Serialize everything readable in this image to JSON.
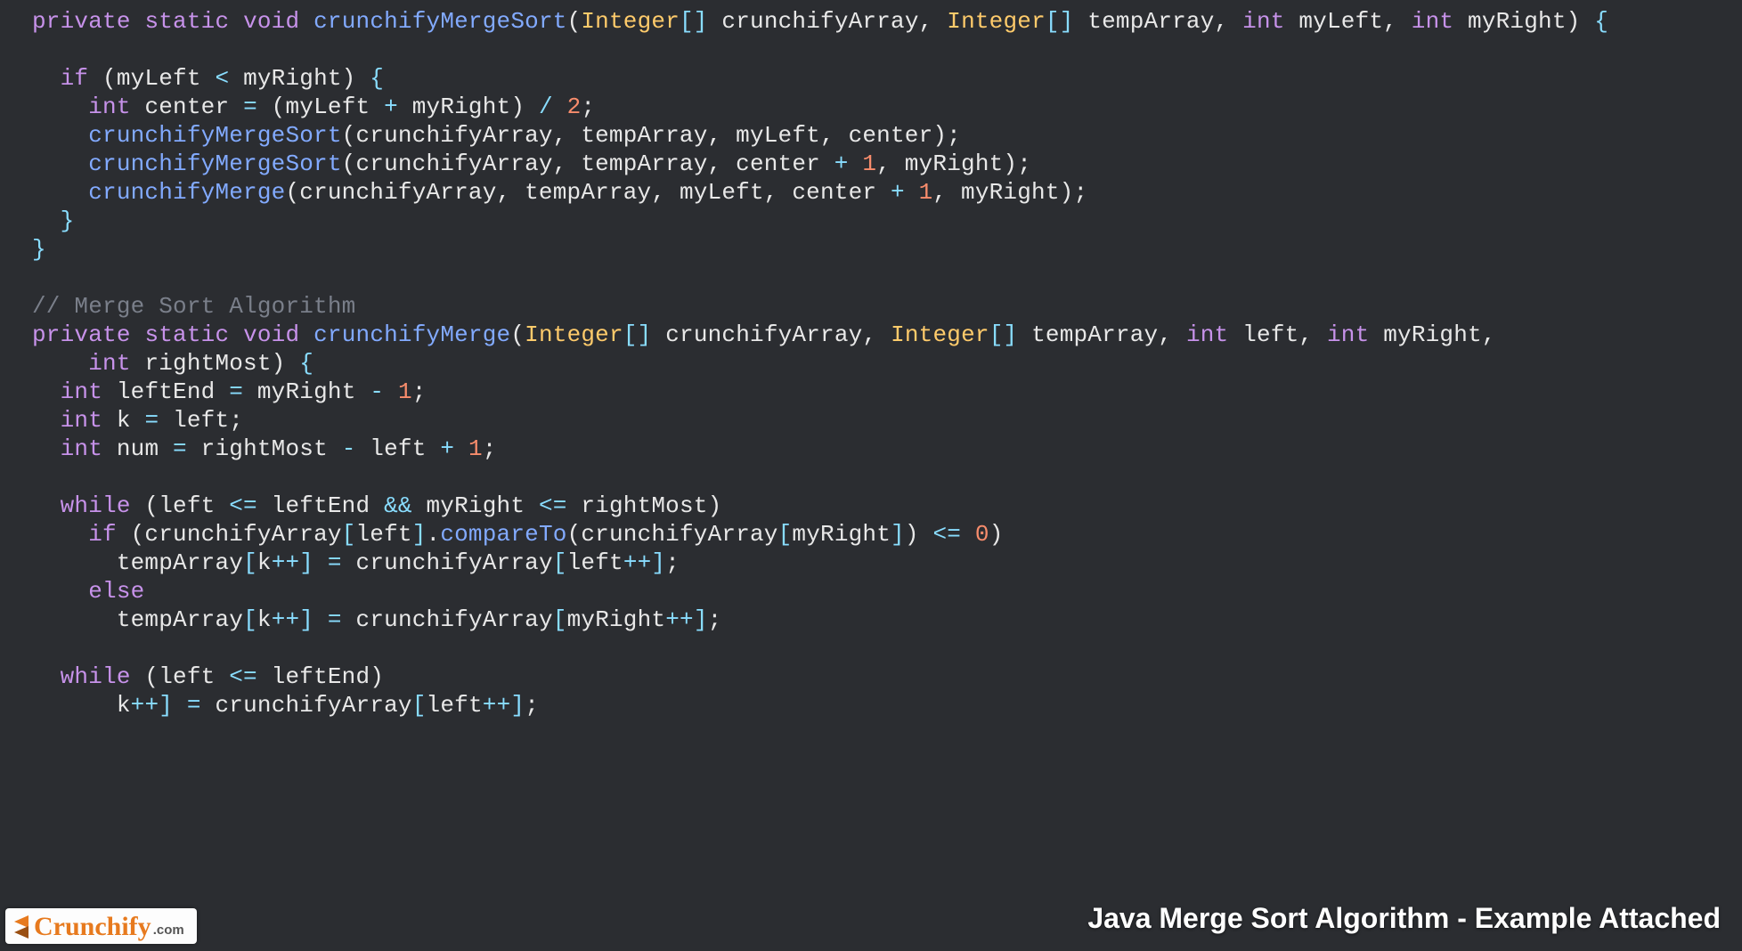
{
  "code": {
    "lines": [
      {
        "i": "",
        "tokens": [
          {
            "c": "kw",
            "t": "private"
          },
          {
            "c": "p",
            "t": " "
          },
          {
            "c": "kw",
            "t": "static"
          },
          {
            "c": "p",
            "t": " "
          },
          {
            "c": "kw",
            "t": "void"
          },
          {
            "c": "p",
            "t": " "
          },
          {
            "c": "fn",
            "t": "crunchifyMergeSort"
          },
          {
            "c": "p",
            "t": "("
          },
          {
            "c": "type",
            "t": "Integer"
          },
          {
            "c": "op",
            "t": "[]"
          },
          {
            "c": "p",
            "t": " crunchifyArray, "
          },
          {
            "c": "type",
            "t": "Integer"
          },
          {
            "c": "op",
            "t": "[]"
          },
          {
            "c": "p",
            "t": " tempArray, "
          },
          {
            "c": "kw",
            "t": "int"
          },
          {
            "c": "p",
            "t": " myLeft, "
          },
          {
            "c": "kw",
            "t": "int"
          },
          {
            "c": "p",
            "t": " myRight) "
          },
          {
            "c": "op",
            "t": "{"
          }
        ]
      },
      {
        "i": "",
        "tokens": []
      },
      {
        "i": "  ",
        "tokens": [
          {
            "c": "kw",
            "t": "if"
          },
          {
            "c": "p",
            "t": " (myLeft "
          },
          {
            "c": "op",
            "t": "<"
          },
          {
            "c": "p",
            "t": " myRight) "
          },
          {
            "c": "op",
            "t": "{"
          }
        ]
      },
      {
        "i": "    ",
        "tokens": [
          {
            "c": "kw",
            "t": "int"
          },
          {
            "c": "p",
            "t": " center "
          },
          {
            "c": "op",
            "t": "="
          },
          {
            "c": "p",
            "t": " (myLeft "
          },
          {
            "c": "op",
            "t": "+"
          },
          {
            "c": "p",
            "t": " myRight) "
          },
          {
            "c": "op",
            "t": "/"
          },
          {
            "c": "p",
            "t": " "
          },
          {
            "c": "num",
            "t": "2"
          },
          {
            "c": "p",
            "t": ";"
          }
        ]
      },
      {
        "i": "    ",
        "tokens": [
          {
            "c": "fn",
            "t": "crunchifyMergeSort"
          },
          {
            "c": "p",
            "t": "(crunchifyArray, tempArray, myLeft, center);"
          }
        ]
      },
      {
        "i": "    ",
        "tokens": [
          {
            "c": "fn",
            "t": "crunchifyMergeSort"
          },
          {
            "c": "p",
            "t": "(crunchifyArray, tempArray, center "
          },
          {
            "c": "op",
            "t": "+"
          },
          {
            "c": "p",
            "t": " "
          },
          {
            "c": "num",
            "t": "1"
          },
          {
            "c": "p",
            "t": ", myRight);"
          }
        ]
      },
      {
        "i": "    ",
        "tokens": [
          {
            "c": "fn",
            "t": "crunchifyMerge"
          },
          {
            "c": "p",
            "t": "(crunchifyArray, tempArray, myLeft, center "
          },
          {
            "c": "op",
            "t": "+"
          },
          {
            "c": "p",
            "t": " "
          },
          {
            "c": "num",
            "t": "1"
          },
          {
            "c": "p",
            "t": ", myRight);"
          }
        ]
      },
      {
        "i": "  ",
        "tokens": [
          {
            "c": "op",
            "t": "}"
          }
        ]
      },
      {
        "i": "",
        "tokens": [
          {
            "c": "op",
            "t": "}"
          }
        ]
      },
      {
        "i": "",
        "tokens": []
      },
      {
        "i": "",
        "tokens": [
          {
            "c": "cmt",
            "t": "// Merge Sort Algorithm"
          }
        ]
      },
      {
        "i": "",
        "tokens": [
          {
            "c": "kw",
            "t": "private"
          },
          {
            "c": "p",
            "t": " "
          },
          {
            "c": "kw",
            "t": "static"
          },
          {
            "c": "p",
            "t": " "
          },
          {
            "c": "kw",
            "t": "void"
          },
          {
            "c": "p",
            "t": " "
          },
          {
            "c": "fn",
            "t": "crunchifyMerge"
          },
          {
            "c": "p",
            "t": "("
          },
          {
            "c": "type",
            "t": "Integer"
          },
          {
            "c": "op",
            "t": "[]"
          },
          {
            "c": "p",
            "t": " crunchifyArray, "
          },
          {
            "c": "type",
            "t": "Integer"
          },
          {
            "c": "op",
            "t": "[]"
          },
          {
            "c": "p",
            "t": " tempArray, "
          },
          {
            "c": "kw",
            "t": "int"
          },
          {
            "c": "p",
            "t": " left, "
          },
          {
            "c": "kw",
            "t": "int"
          },
          {
            "c": "p",
            "t": " myRight,"
          }
        ]
      },
      {
        "i": "    ",
        "tokens": [
          {
            "c": "kw",
            "t": "int"
          },
          {
            "c": "p",
            "t": " rightMost) "
          },
          {
            "c": "op",
            "t": "{"
          }
        ]
      },
      {
        "i": "  ",
        "tokens": [
          {
            "c": "kw",
            "t": "int"
          },
          {
            "c": "p",
            "t": " leftEnd "
          },
          {
            "c": "op",
            "t": "="
          },
          {
            "c": "p",
            "t": " myRight "
          },
          {
            "c": "op",
            "t": "-"
          },
          {
            "c": "p",
            "t": " "
          },
          {
            "c": "num",
            "t": "1"
          },
          {
            "c": "p",
            "t": ";"
          }
        ]
      },
      {
        "i": "  ",
        "tokens": [
          {
            "c": "kw",
            "t": "int"
          },
          {
            "c": "p",
            "t": " k "
          },
          {
            "c": "op",
            "t": "="
          },
          {
            "c": "p",
            "t": " left;"
          }
        ]
      },
      {
        "i": "  ",
        "tokens": [
          {
            "c": "kw",
            "t": "int"
          },
          {
            "c": "p",
            "t": " num "
          },
          {
            "c": "op",
            "t": "="
          },
          {
            "c": "p",
            "t": " rightMost "
          },
          {
            "c": "op",
            "t": "-"
          },
          {
            "c": "p",
            "t": " left "
          },
          {
            "c": "op",
            "t": "+"
          },
          {
            "c": "p",
            "t": " "
          },
          {
            "c": "num",
            "t": "1"
          },
          {
            "c": "p",
            "t": ";"
          }
        ]
      },
      {
        "i": "",
        "tokens": []
      },
      {
        "i": "  ",
        "tokens": [
          {
            "c": "kw",
            "t": "while"
          },
          {
            "c": "p",
            "t": " (left "
          },
          {
            "c": "op",
            "t": "<="
          },
          {
            "c": "p",
            "t": " leftEnd "
          },
          {
            "c": "op",
            "t": "&&"
          },
          {
            "c": "p",
            "t": " myRight "
          },
          {
            "c": "op",
            "t": "<="
          },
          {
            "c": "p",
            "t": " rightMost)"
          }
        ]
      },
      {
        "i": "    ",
        "tokens": [
          {
            "c": "kw",
            "t": "if"
          },
          {
            "c": "p",
            "t": " (crunchifyArray"
          },
          {
            "c": "op",
            "t": "["
          },
          {
            "c": "p",
            "t": "left"
          },
          {
            "c": "op",
            "t": "]"
          },
          {
            "c": "p",
            "t": "."
          },
          {
            "c": "fn",
            "t": "compareTo"
          },
          {
            "c": "p",
            "t": "(crunchifyArray"
          },
          {
            "c": "op",
            "t": "["
          },
          {
            "c": "p",
            "t": "myRight"
          },
          {
            "c": "op",
            "t": "]"
          },
          {
            "c": "p",
            "t": ") "
          },
          {
            "c": "op",
            "t": "<="
          },
          {
            "c": "p",
            "t": " "
          },
          {
            "c": "num",
            "t": "0"
          },
          {
            "c": "p",
            "t": ")"
          }
        ]
      },
      {
        "i": "      ",
        "tokens": [
          {
            "c": "p",
            "t": "tempArray"
          },
          {
            "c": "op",
            "t": "["
          },
          {
            "c": "p",
            "t": "k"
          },
          {
            "c": "op",
            "t": "++"
          },
          {
            "c": "op",
            "t": "]"
          },
          {
            "c": "p",
            "t": " "
          },
          {
            "c": "op",
            "t": "="
          },
          {
            "c": "p",
            "t": " crunchifyArray"
          },
          {
            "c": "op",
            "t": "["
          },
          {
            "c": "p",
            "t": "left"
          },
          {
            "c": "op",
            "t": "++"
          },
          {
            "c": "op",
            "t": "]"
          },
          {
            "c": "p",
            "t": ";"
          }
        ]
      },
      {
        "i": "    ",
        "tokens": [
          {
            "c": "kw",
            "t": "else"
          }
        ]
      },
      {
        "i": "      ",
        "tokens": [
          {
            "c": "p",
            "t": "tempArray"
          },
          {
            "c": "op",
            "t": "["
          },
          {
            "c": "p",
            "t": "k"
          },
          {
            "c": "op",
            "t": "++"
          },
          {
            "c": "op",
            "t": "]"
          },
          {
            "c": "p",
            "t": " "
          },
          {
            "c": "op",
            "t": "="
          },
          {
            "c": "p",
            "t": " crunchifyArray"
          },
          {
            "c": "op",
            "t": "["
          },
          {
            "c": "p",
            "t": "myRight"
          },
          {
            "c": "op",
            "t": "++"
          },
          {
            "c": "op",
            "t": "]"
          },
          {
            "c": "p",
            "t": ";"
          }
        ]
      },
      {
        "i": "",
        "tokens": []
      },
      {
        "i": "  ",
        "tokens": [
          {
            "c": "kw",
            "t": "while"
          },
          {
            "c": "p",
            "t": " (left "
          },
          {
            "c": "op",
            "t": "<="
          },
          {
            "c": "p",
            "t": " leftEnd)"
          }
        ]
      },
      {
        "i": "      ",
        "tokens": [
          {
            "c": "p",
            "t": "k"
          },
          {
            "c": "op",
            "t": "++"
          },
          {
            "c": "op",
            "t": "]"
          },
          {
            "c": "p",
            "t": " "
          },
          {
            "c": "op",
            "t": "="
          },
          {
            "c": "p",
            "t": " crunchifyArray"
          },
          {
            "c": "op",
            "t": "["
          },
          {
            "c": "p",
            "t": "left"
          },
          {
            "c": "op",
            "t": "++"
          },
          {
            "c": "op",
            "t": "]"
          },
          {
            "c": "p",
            "t": ";"
          }
        ]
      }
    ]
  },
  "logo": {
    "brand": "Crunchify",
    "tld": ".com"
  },
  "caption": "Java Merge Sort Algorithm - Example Attached"
}
